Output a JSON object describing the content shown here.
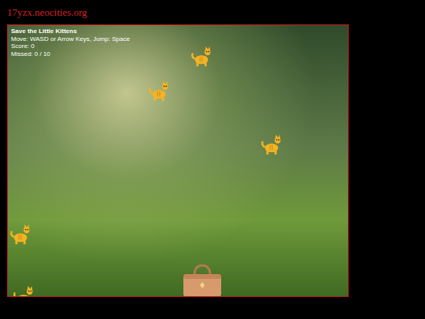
{
  "page": {
    "site_title": "17yzx.neocities.org"
  },
  "hud": {
    "title": "Save the Little Kittens",
    "controls": "Move: WASD or Arrow Keys, Jump: Space",
    "score": "Score: 0",
    "missed": "Missed: 0 / 10"
  },
  "game": {
    "kitten_count": 5,
    "has_basket": true
  }
}
